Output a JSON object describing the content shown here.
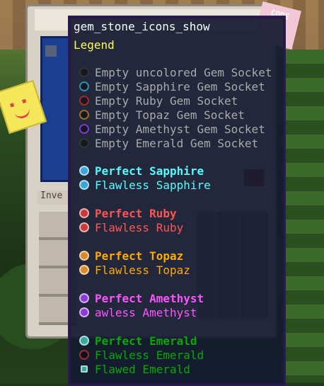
{
  "tooltip": {
    "title": "gem_stone_icons_show",
    "legend_label": "Legend",
    "sockets": [
      {
        "label": "Empty uncolored Gem Socket",
        "color": "#333333",
        "icon": "empty-socket-icon"
      },
      {
        "label": "Empty Sapphire Gem Socket",
        "color": "#2f8fa8",
        "icon": "empty-socket-icon"
      },
      {
        "label": "Empty Ruby Gem Socket",
        "color": "#9e2b2b",
        "icon": "empty-socket-icon"
      },
      {
        "label": "Empty Topaz Gem Socket",
        "color": "#9a6a2a",
        "icon": "empty-socket-icon"
      },
      {
        "label": "Empty Amethyst Gem Socket",
        "color": "#7a3ad0",
        "icon": "empty-socket-icon"
      },
      {
        "label": "Empty Emerald Gem Socket",
        "color": "#2a3a2a",
        "icon": "empty-socket-icon"
      }
    ],
    "groups": [
      {
        "color": "#55ffff",
        "gem_color": "#3aa6d6",
        "items": [
          {
            "label": "Perfect Sapphire",
            "bold": true,
            "icon": "perfect-sapphire-icon"
          },
          {
            "label": "Flawless Sapphire",
            "bold": false,
            "icon": "flawless-sapphire-icon"
          }
        ]
      },
      {
        "color": "#ff5555",
        "gem_color": "#c83a3a",
        "items": [
          {
            "label": "Perfect Ruby",
            "bold": true,
            "icon": "perfect-ruby-icon"
          },
          {
            "label": "Flawless Ruby",
            "bold": false,
            "icon": "flawless-ruby-icon"
          }
        ]
      },
      {
        "color": "#ffaa00",
        "gem_color": "#d68a2a",
        "items": [
          {
            "label": "Perfect Topaz",
            "bold": true,
            "icon": "perfect-topaz-icon"
          },
          {
            "label": "Flawless Topaz",
            "bold": false,
            "icon": "flawless-topaz-icon"
          }
        ]
      },
      {
        "color": "#ff55ff",
        "gem_color": "#8a3ad6",
        "items": [
          {
            "label": "Perfect Amethyst",
            "bold": true,
            "icon": "perfect-amethyst-icon"
          },
          {
            "label": "awless Amethyst",
            "bold": false,
            "icon": "flawless-amethyst-icon"
          }
        ]
      },
      {
        "color": "#00aa00",
        "gem_color": "#3aa6a0",
        "items": [
          {
            "label": "Perfect Emerald",
            "bold": true,
            "icon": "perfect-emerald-icon"
          },
          {
            "label": "Flawless Emerald",
            "bold": false,
            "icon": "empty-socket-icon",
            "socket_color": "#9e2b2b"
          },
          {
            "label": "Flawed Emerald",
            "bold": false,
            "icon": "flawed-emerald-icon"
          }
        ]
      }
    ]
  },
  "gui": {
    "inventory_label": "Inve",
    "sticker_text": "CODE"
  },
  "colors": {
    "empty_socket_text": "#aaaaaa",
    "tooltip_bg": "#141a30",
    "legend": "#fdfd54"
  }
}
